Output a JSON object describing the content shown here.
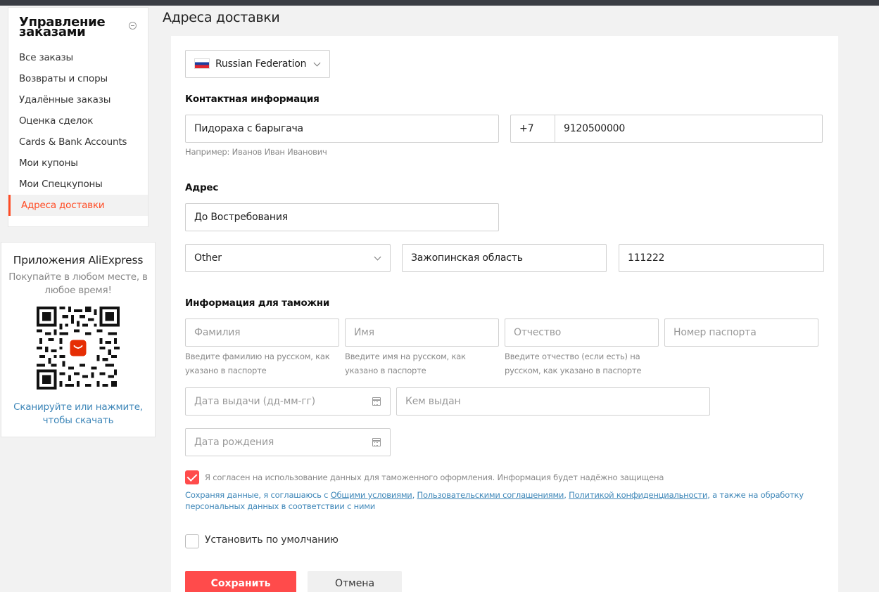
{
  "sidebar": {
    "title": "Управление заказами",
    "items": [
      {
        "label": "Все заказы"
      },
      {
        "label": "Возвраты и споры"
      },
      {
        "label": "Удалённые заказы"
      },
      {
        "label": "Оценка сделок"
      },
      {
        "label": "Cards & Bank Accounts"
      },
      {
        "label": "Мои купоны"
      },
      {
        "label": "Мои Спецкупоны"
      },
      {
        "label": "Адреса доставки",
        "active": true
      }
    ]
  },
  "app_promo": {
    "title": "Приложения AliExpress",
    "subtitle": "Покупайте в любом месте, в любое время!",
    "link": "Сканируйте или нажмите, чтобы скачать"
  },
  "page": {
    "title": "Адреса доставки"
  },
  "form": {
    "country": "Russian Federation",
    "contact_label": "Контактная информация",
    "name_value": "Пидораха  с барыгача",
    "name_hint": "Например: Иванов Иван Иванович",
    "phone_code": "+7",
    "phone_number": "9120500000",
    "address_label": "Адрес",
    "street_value": "До Востребования",
    "region_select": "Other",
    "province_value": "Зажопинская область",
    "zip_value": "111222",
    "customs_label": "Информация для таможни",
    "surname_placeholder": "Фамилия",
    "surname_hint": "Введите фамилию на русском, как указано в паспорте",
    "firstname_placeholder": "Имя",
    "firstname_hint": "Введите имя на русском, как указано в паспорте",
    "patronymic_placeholder": "Отчество",
    "patronymic_hint": "Введите отчество (если есть) на русском, как указано в паспорте",
    "passport_placeholder": "Номер паспорта",
    "issue_date_placeholder": "Дата выдачи (дд-мм-гг)",
    "issued_by_placeholder": "Кем выдан",
    "birth_date_placeholder": "Дата рождения",
    "consent_text": "Я согласен на использование данных для таможенного оформления. Информация будет надёжно защищена",
    "consent_checked": true,
    "legal_prefix": "Сохраняя данные, я соглашаюсь с ",
    "legal_link_terms": "Общими условиями",
    "legal_sep1": ", ",
    "legal_link_user": "Пользовательскими соглашениями",
    "legal_sep2": ", ",
    "legal_link_privacy": "Политикой конфиденциальности",
    "legal_suffix": ", а также на обработку персональных данных в соответствии с ними",
    "default_label": "Установить по умолчанию",
    "default_checked": false,
    "save_label": "Сохранить",
    "cancel_label": "Отмена"
  },
  "colors": {
    "accent": "#ff4b4b",
    "active_menu": "#ff4b24",
    "link": "#3d86b8"
  }
}
